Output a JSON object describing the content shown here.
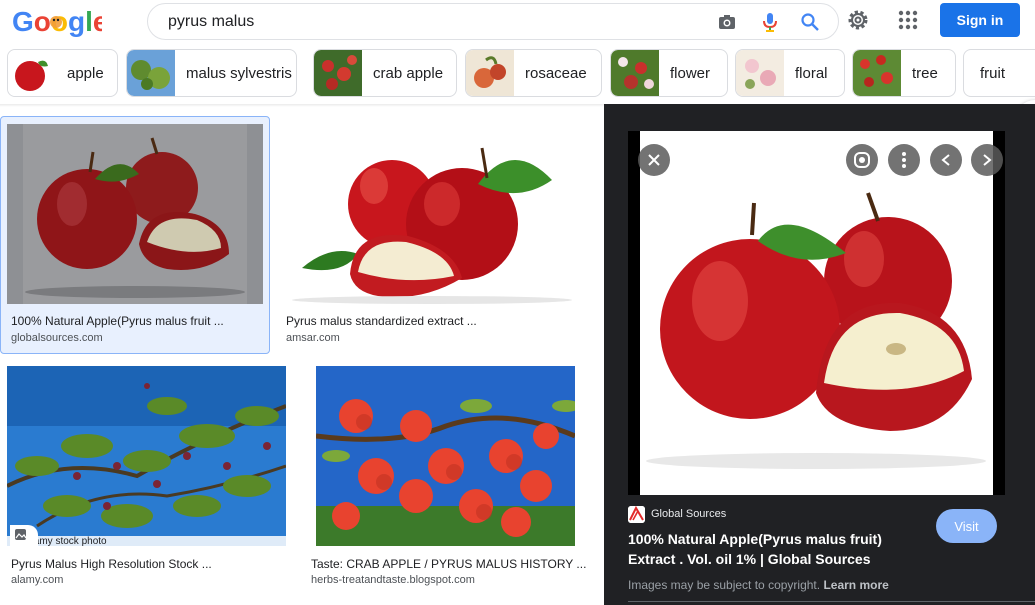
{
  "search": {
    "query": "pyrus malus"
  },
  "header": {
    "signin_label": "Sign in",
    "logo_text": "Google"
  },
  "chips": [
    {
      "label": "apple"
    },
    {
      "label": "malus sylvestris"
    },
    {
      "label": "crab apple"
    },
    {
      "label": "rosaceae"
    },
    {
      "label": "flower"
    },
    {
      "label": "floral"
    },
    {
      "label": "tree"
    },
    {
      "label": "fruit"
    }
  ],
  "results": [
    {
      "title": "100% Natural Apple(Pyrus malus fruit ...",
      "domain": "globalsources.com"
    },
    {
      "title": "Pyrus malus standardized extract ...",
      "domain": "amsar.com"
    },
    {
      "title": "Pyrus Malus High Resolution Stock ...",
      "domain": "alamy.com",
      "watermark": "alamy stock photo"
    },
    {
      "title": "Taste: CRAB APPLE / PYRUS MALUS HISTORY ...",
      "domain": "herbs-treatandtaste.blogspot.com"
    }
  ],
  "preview": {
    "source": "Global Sources",
    "title": "100% Natural Apple(Pyrus malus fruit) Extract . Vol. oil 1% | Global Sources",
    "visit_label": "Visit",
    "copyright": "Images may be subject to copyright.",
    "learn_more": "Learn more"
  },
  "colors": {
    "accent": "#1a73e8",
    "panel_bg": "#202124",
    "selected_bg": "#e8f0fe",
    "apple_red": "#c8161d"
  }
}
